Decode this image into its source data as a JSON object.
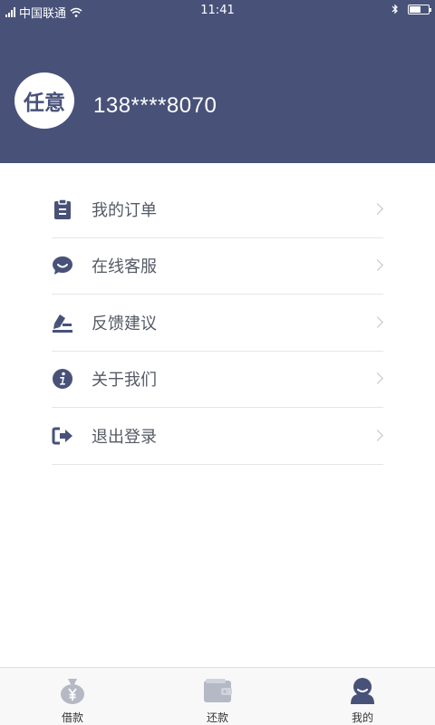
{
  "status_bar": {
    "carrier": "中国联通",
    "time": "11:41"
  },
  "profile": {
    "avatar_text": "任意",
    "phone": "138****8070"
  },
  "menu": {
    "items": [
      {
        "label": "我的订单",
        "icon": "clipboard-icon"
      },
      {
        "label": "在线客服",
        "icon": "chat-bubble-icon"
      },
      {
        "label": "反馈建议",
        "icon": "edit-pen-icon"
      },
      {
        "label": "关于我们",
        "icon": "info-icon"
      },
      {
        "label": "退出登录",
        "icon": "logout-icon"
      }
    ]
  },
  "tabbar": {
    "items": [
      {
        "label": "借款",
        "icon": "money-bag-icon"
      },
      {
        "label": "还款",
        "icon": "wallet-icon"
      },
      {
        "label": "我的",
        "icon": "user-icon",
        "active": true
      }
    ]
  },
  "colors": {
    "header_bg": "#485279",
    "icon_accent": "#485279",
    "tab_inactive": "#b5b9c5"
  }
}
